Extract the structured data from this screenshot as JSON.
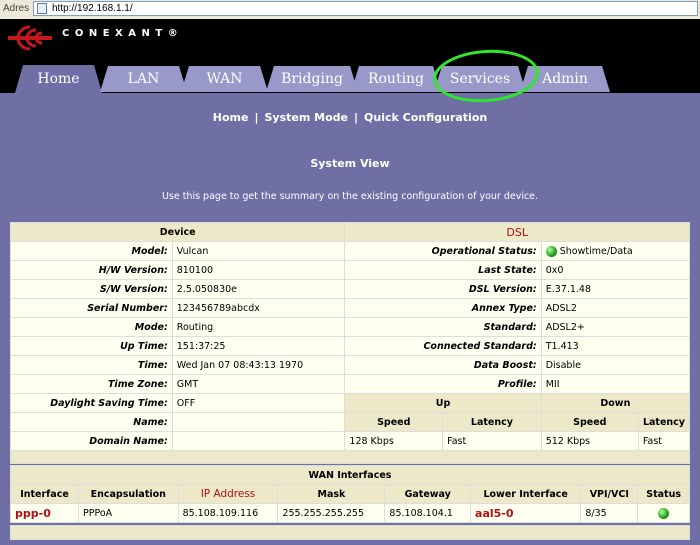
{
  "browser": {
    "address_label": "Adres",
    "url": "http://192.168.1.1/"
  },
  "brand": {
    "name": "CONEXANT",
    "trademark": "®"
  },
  "tabs": [
    {
      "label": "Home",
      "active": true
    },
    {
      "label": "LAN"
    },
    {
      "label": "WAN"
    },
    {
      "label": "Bridging"
    },
    {
      "label": "Routing"
    },
    {
      "label": "Services"
    },
    {
      "label": "Admin"
    }
  ],
  "subnav": {
    "home": "Home",
    "system_mode": "System Mode",
    "quick_config": "Quick Configuration",
    "sep": "|"
  },
  "page": {
    "title": "System View",
    "description": "Use this page to get the summary on the existing configuration of your device."
  },
  "device": {
    "header": "Device",
    "rows": [
      {
        "label": "Model:",
        "value": "Vulcan"
      },
      {
        "label": "H/W Version:",
        "value": "810100"
      },
      {
        "label": "S/W Version:",
        "value": "2.5.050830e"
      },
      {
        "label": "Serial Number:",
        "value": "123456789abcdx"
      },
      {
        "label": "Mode:",
        "value": "Routing"
      },
      {
        "label": "Up Time:",
        "value": "151:37:25"
      },
      {
        "label": "Time:",
        "value": "Wed Jan 07 08:43:13 1970"
      },
      {
        "label": "Time Zone:",
        "value": "GMT"
      },
      {
        "label": "Daylight Saving Time:",
        "value": "OFF"
      },
      {
        "label": "Name:",
        "value": ""
      },
      {
        "label": "Domain Name:",
        "value": ""
      }
    ]
  },
  "dsl": {
    "header": "DSL",
    "rows": [
      {
        "label": "Operational Status:",
        "value": "Showtime/Data"
      },
      {
        "label": "Last State:",
        "value": "0x0"
      },
      {
        "label": "DSL Version:",
        "value": "E.37.1.48"
      },
      {
        "label": "Annex Type:",
        "value": "ADSL2"
      },
      {
        "label": "Standard:",
        "value": "ADSL2+"
      },
      {
        "label": "Connected Standard:",
        "value": "T1.413"
      },
      {
        "label": "Data Boost:",
        "value": "Disable"
      },
      {
        "label": "Profile:",
        "value": "MII"
      }
    ],
    "up": "Up",
    "down": "Down",
    "speed": "Speed",
    "latency": "Latency",
    "up_speed": "128 Kbps",
    "up_latency": "Fast",
    "down_speed": "512 Kbps",
    "down_latency": "Fast",
    "status_color": "#1e9c1e"
  },
  "wan": {
    "header": "WAN Interfaces",
    "columns": [
      "Interface",
      "Encapsulation",
      "IP Address",
      "Mask",
      "Gateway",
      "Lower Interface",
      "VPI/VCI",
      "Status"
    ],
    "row": {
      "interface": "ppp-0",
      "encapsulation": "PPPoA",
      "ip": "85.108.109.116",
      "mask": "255.255.255.255",
      "gateway": "85.108.104.1",
      "lower": "aal5-0",
      "vpivci": "8/35"
    }
  },
  "annotation": {
    "color": "#2ee82e",
    "target": "Services"
  }
}
